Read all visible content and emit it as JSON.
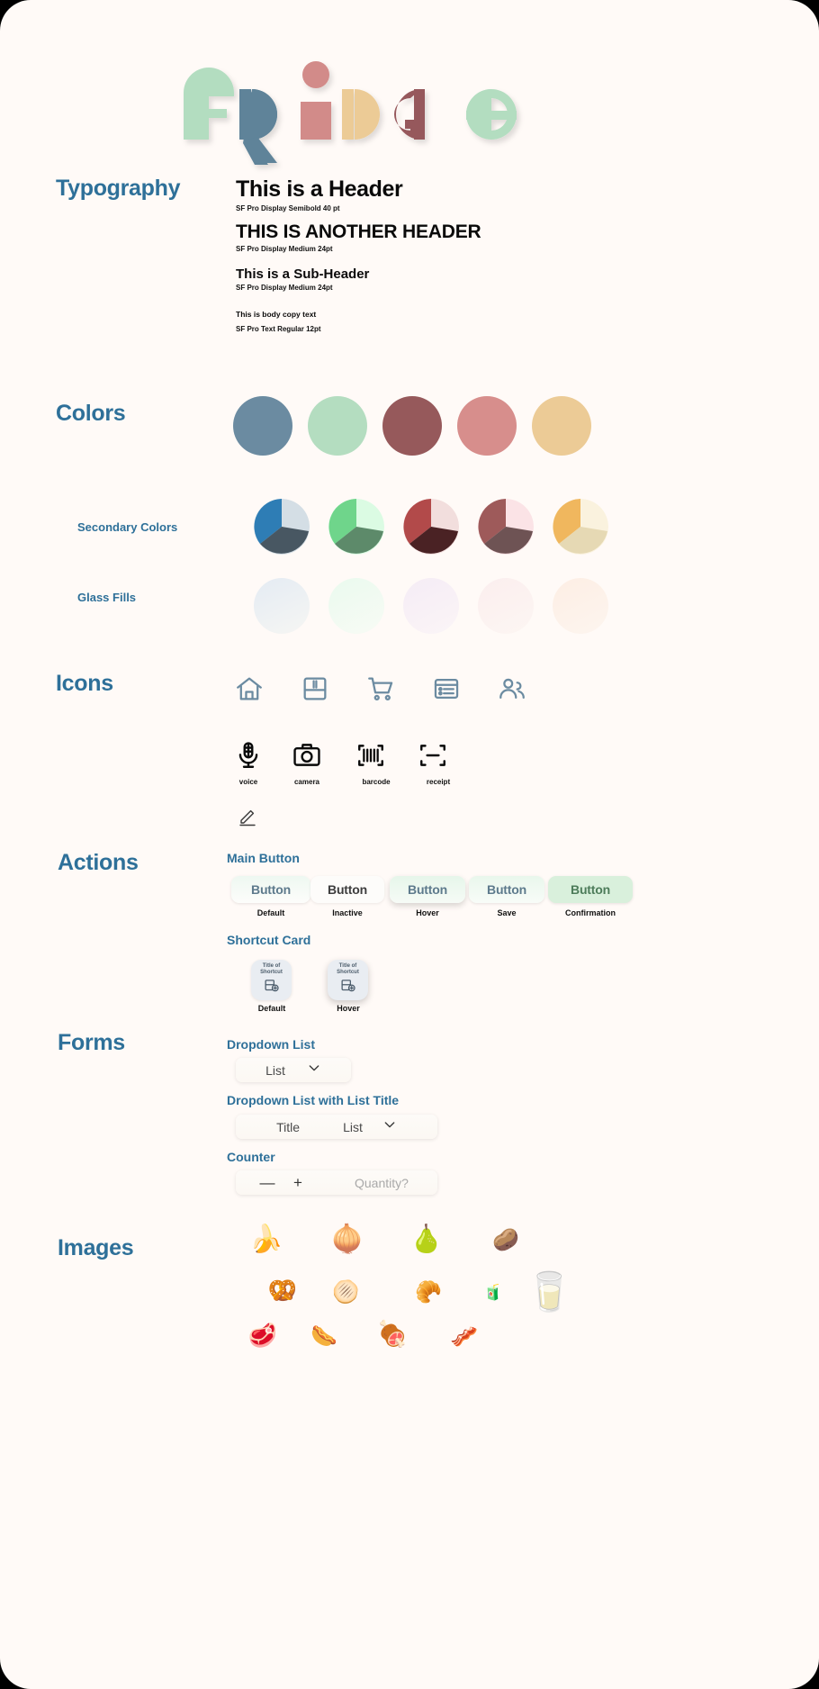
{
  "brand": {
    "name": "FRIDGE",
    "logo_letters": [
      "F",
      "R",
      "I",
      "D",
      "G",
      "E"
    ],
    "logo_colors": [
      "#b3ddc0",
      "#5e8399",
      "#d28b89",
      "#eccb96",
      "#96595b",
      "#b3ddc0"
    ]
  },
  "sections": {
    "typography": "Typography",
    "colors": "Colors",
    "icons": "Icons",
    "actions": "Actions",
    "forms": "Forms",
    "images": "Images"
  },
  "typography": {
    "items": [
      {
        "text": "This is a Header",
        "caption": "SF Pro Display Semibold 40 pt"
      },
      {
        "text": "THIS IS ANOTHER HEADER",
        "caption": "SF Pro Display Medium 24pt"
      },
      {
        "text": "This is a Sub-Header",
        "caption": "SF Pro Display Medium 24pt"
      },
      {
        "text": "This is body copy text",
        "caption": "SF Pro Text Regular 12pt"
      }
    ]
  },
  "colors": {
    "secondary_label": "Secondary Colors",
    "glass_label": "Glass Fills",
    "primary": [
      "#6b8ba1",
      "#b4ddc0",
      "#96595b",
      "#d78e8c",
      "#eccb96"
    ],
    "secondary": [
      {
        "light": "#d4dee5",
        "mid": "#2e7db5",
        "dark": "#485762"
      },
      {
        "light": "#dbfbe3",
        "mid": "#6fd58b",
        "dark": "#5d8a6a"
      },
      {
        "light": "#f2dedd",
        "mid": "#b24a4a",
        "dark": "#4a2224"
      },
      {
        "light": "#fbe3e6",
        "mid": "#9e5a5a",
        "dark": "#6e5354"
      },
      {
        "light": "#faf2de",
        "mid": "#f0b75e",
        "dark": "#e6d9b4"
      }
    ],
    "glass": [
      "#e9eef4",
      "#eefaf1",
      "#f6eef6",
      "#fbf0f0",
      "#fdefe7"
    ]
  },
  "icons": {
    "row1": [
      "home-icon",
      "fridge-icon",
      "cart-icon",
      "list-icon",
      "people-icon"
    ],
    "row2": [
      {
        "name": "microphone-icon",
        "label": "voice"
      },
      {
        "name": "camera-icon",
        "label": "camera"
      },
      {
        "name": "barcode-icon",
        "label": "barcode"
      },
      {
        "name": "receipt-scan-icon",
        "label": "receipt"
      }
    ],
    "row3": [
      {
        "name": "pencil-edit-icon",
        "label": ""
      }
    ]
  },
  "actions": {
    "main_button_label": "Main Button",
    "buttons": [
      {
        "text": "Button",
        "state": "Default"
      },
      {
        "text": "Button",
        "state": "Inactive"
      },
      {
        "text": "Button",
        "state": "Hover"
      },
      {
        "text": "Button",
        "state": "Save"
      },
      {
        "text": "Button",
        "state": "Confirmation"
      }
    ],
    "shortcut_card_label": "Shortcut Card",
    "shortcut_cards": [
      {
        "title": "Title of Shortcut",
        "state": "Default"
      },
      {
        "title": "Title of Shortcut",
        "state": "Hover"
      }
    ]
  },
  "forms": {
    "dropdown_label": "Dropdown List",
    "dropdown": {
      "value": "List",
      "chevron": "chevron-down-icon"
    },
    "dropdown_title_label": "Dropdown List with List Title",
    "dropdown_with_title": {
      "title": "Title",
      "value": "List",
      "chevron": "chevron-down-icon"
    },
    "counter_label": "Counter",
    "counter": {
      "minus": "—",
      "plus": "+",
      "placeholder": "Quantity?"
    }
  },
  "images": {
    "row1": [
      "🍌",
      "🧅",
      "🍐",
      "🥔"
    ],
    "row2": [
      "🥨",
      "🫓",
      "🥐",
      "🧃",
      "🥛"
    ],
    "row3": [
      "🥩",
      "🌭",
      "🍖",
      "🥓"
    ]
  }
}
